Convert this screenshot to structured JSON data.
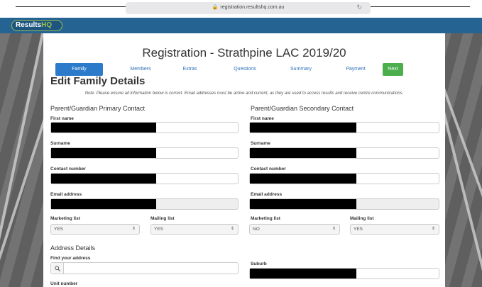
{
  "browser": {
    "url": "registration.resultshq.com.au"
  },
  "brand": {
    "name_a": "Results",
    "name_b": "HQ"
  },
  "page": {
    "title": "Registration - Strathpine LAC 2019/20",
    "section_title": "Edit Family Details",
    "note": "Note: Please ensure all information below is correct. Email addresses must be active and current, as they are used to access results and receive centre communications."
  },
  "steps": [
    "Family",
    "Members",
    "Extras",
    "Questions",
    "Summary",
    "Payment"
  ],
  "next_label": "Next",
  "primary": {
    "heading": "Parent/Guardian Primary Contact",
    "first_name_label": "First name",
    "surname_label": "Surname",
    "contact_label": "Contact number",
    "email_label": "Email address",
    "marketing_label": "Marketing list",
    "marketing_value": "YES",
    "mailing_label": "Mailing list",
    "mailing_value": "YES"
  },
  "secondary": {
    "heading": "Parent/Guardian Secondary Contact",
    "first_name_label": "First name",
    "surname_label": "Surname",
    "contact_label": "Contact number",
    "email_label": "Email address",
    "marketing_label": "Marketing list",
    "marketing_value": "NO",
    "mailing_label": "Mailing list",
    "mailing_value": "YES"
  },
  "address": {
    "heading": "Address Details",
    "find_label": "Find your address",
    "suburb_label": "Suburb",
    "unit_label": "Unit number"
  },
  "icons": {
    "search": "search-icon",
    "lock": "lock-icon",
    "reload": "reload-icon",
    "caret": "select-caret-icon"
  },
  "colors": {
    "brand_bar": "#256393",
    "active_step": "#2c7bcb",
    "next_button": "#4cae4c",
    "logo_accent": "#9ac04c"
  }
}
